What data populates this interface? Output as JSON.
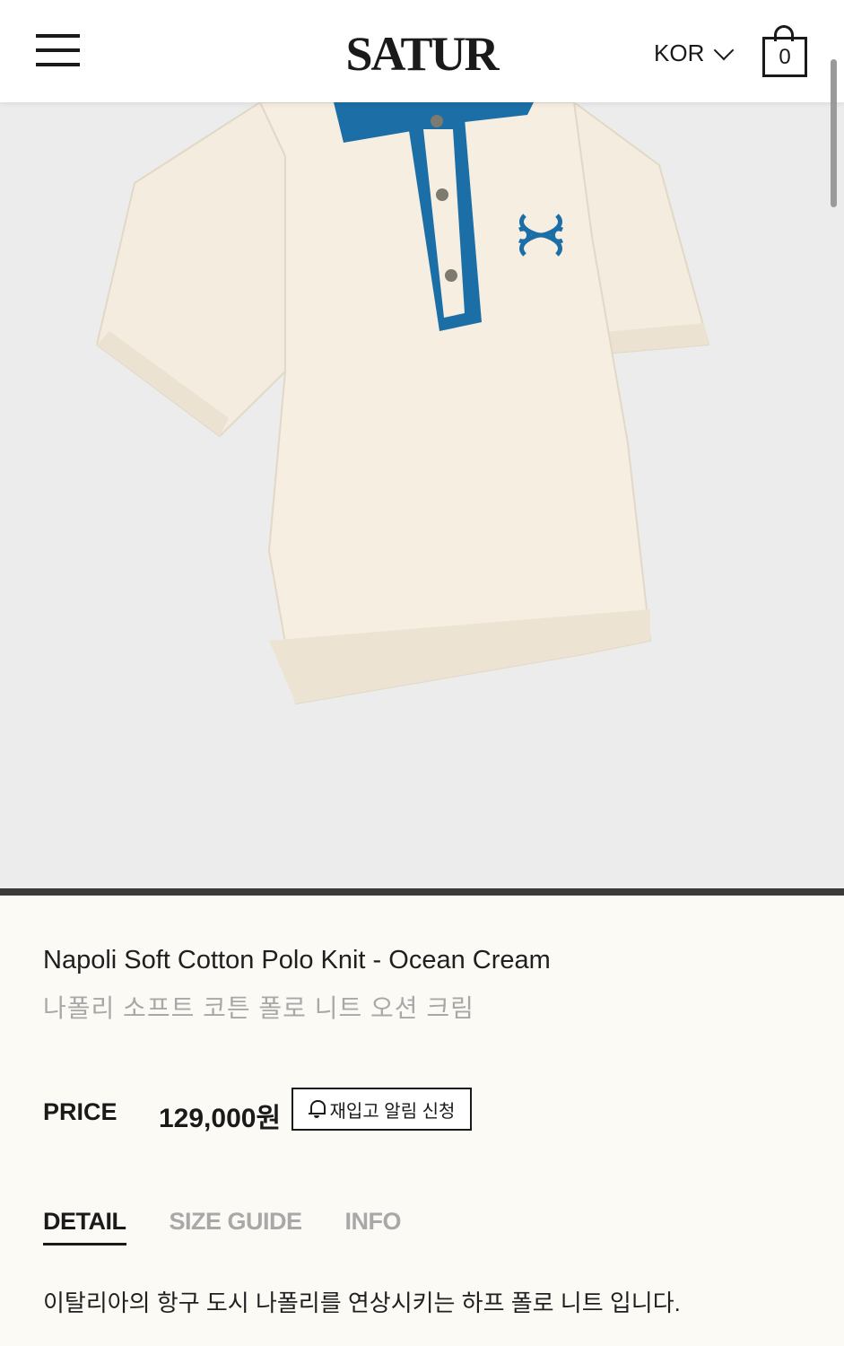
{
  "header": {
    "logo": "SATUR",
    "language": "KOR",
    "cart_count": "0"
  },
  "product": {
    "name_en": "Napoli Soft Cotton Polo Knit - Ocean Cream",
    "name_ko": "나폴리 소프트 코튼 폴로 니트 오션 크림",
    "price_label": "PRICE",
    "price": "129,000원",
    "restock_label": "재입고 알림 신청",
    "image": {
      "body_color": "#f3ecdf",
      "accent_color": "#1c6fa6"
    }
  },
  "tabs": [
    {
      "label": "DETAIL",
      "active": true
    },
    {
      "label": "SIZE GUIDE",
      "active": false
    },
    {
      "label": "INFO",
      "active": false
    }
  ],
  "detail_text": "이탈리아의 항구 도시 나폴리를 연상시키는 하프 폴로 니트 입니다."
}
